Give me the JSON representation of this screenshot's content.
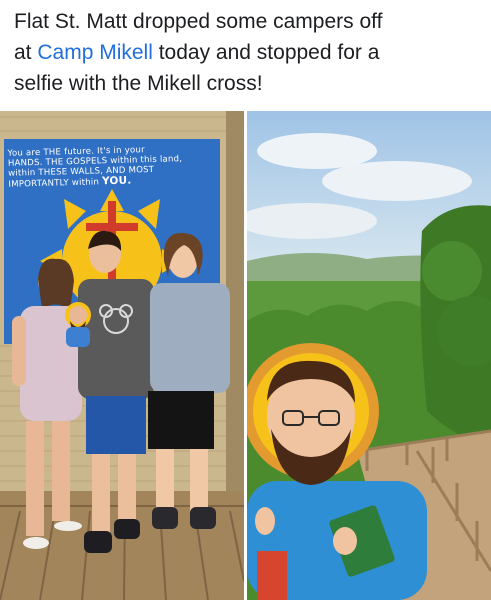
{
  "post": {
    "text_line1": "Flat St. Matt dropped some campers off",
    "text_prefix2": "at ",
    "link_text": "Camp Mikell",
    "text_suffix2": " today and stopped for a",
    "text_line3": "selfie with the Mikell cross!"
  },
  "photos": {
    "left": {
      "mural": {
        "line1": "You are THE future. It's in your",
        "line2": "HANDS. THE GOSPELS within this land,",
        "line3": "within THESE WALLS, AND MOST",
        "line4": "IMPORTANTLY      within",
        "line4_big": "YOU."
      }
    }
  },
  "colors": {
    "link": "#216fdb",
    "text": "#1c1e21",
    "mural_blue": "#2f6fc4",
    "sun": "#f6c21a"
  },
  "icons": [
    "flat-st-matt-cutout",
    "sun-cross-mural"
  ]
}
